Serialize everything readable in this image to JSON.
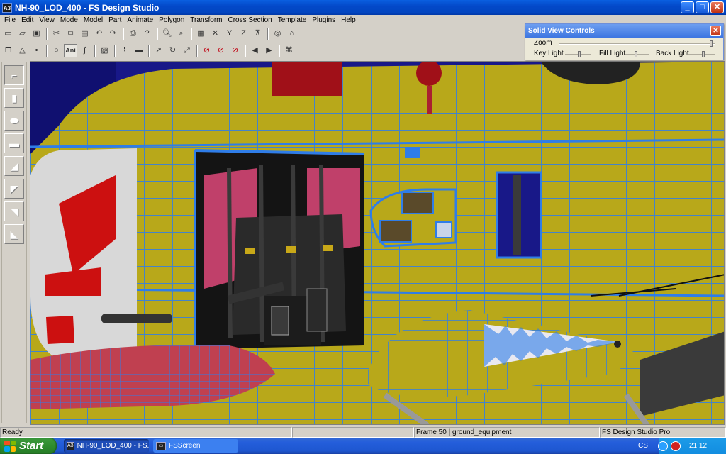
{
  "window": {
    "title": "NH-90_LOD_400 - FS Design Studio",
    "app_icon": "A3"
  },
  "menu": [
    "File",
    "Edit",
    "View",
    "Mode",
    "Model",
    "Part",
    "Animate",
    "Polygon",
    "Transform",
    "Cross Section",
    "Template",
    "Plugins",
    "Help"
  ],
  "toolbar2": {
    "ani_label": "Ani"
  },
  "solid_view_controls": {
    "title": "Solid View Controls",
    "zoom": "Zoom",
    "key_light": "Key Light",
    "fill_light": "Fill Light",
    "back_light": "Back Light",
    "zoom_level": 0.98,
    "key_level": 0.55,
    "fill_level": 0.45,
    "back_level": 0.55
  },
  "status": {
    "left": "Ready",
    "frame": "Frame 50 | ground_equipment",
    "app": "FS Design Studio Pro"
  },
  "taskbar": {
    "start": "Start",
    "task1": "NH-90_LOD_400 - FS...",
    "task2": "FSScreen",
    "lang": "CS",
    "clock": "21:12"
  },
  "colors": {
    "hull": "#b8a81a",
    "wire": "#2f7de8",
    "bg": "#181888",
    "xp_blue": "#245edb"
  },
  "icons": [
    "new-icon",
    "open-icon",
    "save-icon",
    "cut-icon",
    "copy-icon",
    "paste-icon",
    "undo-icon",
    "redo-icon",
    "print-icon",
    "help-icon",
    "zoom-in-icon",
    "zoom-out-icon",
    "grid-icon"
  ]
}
